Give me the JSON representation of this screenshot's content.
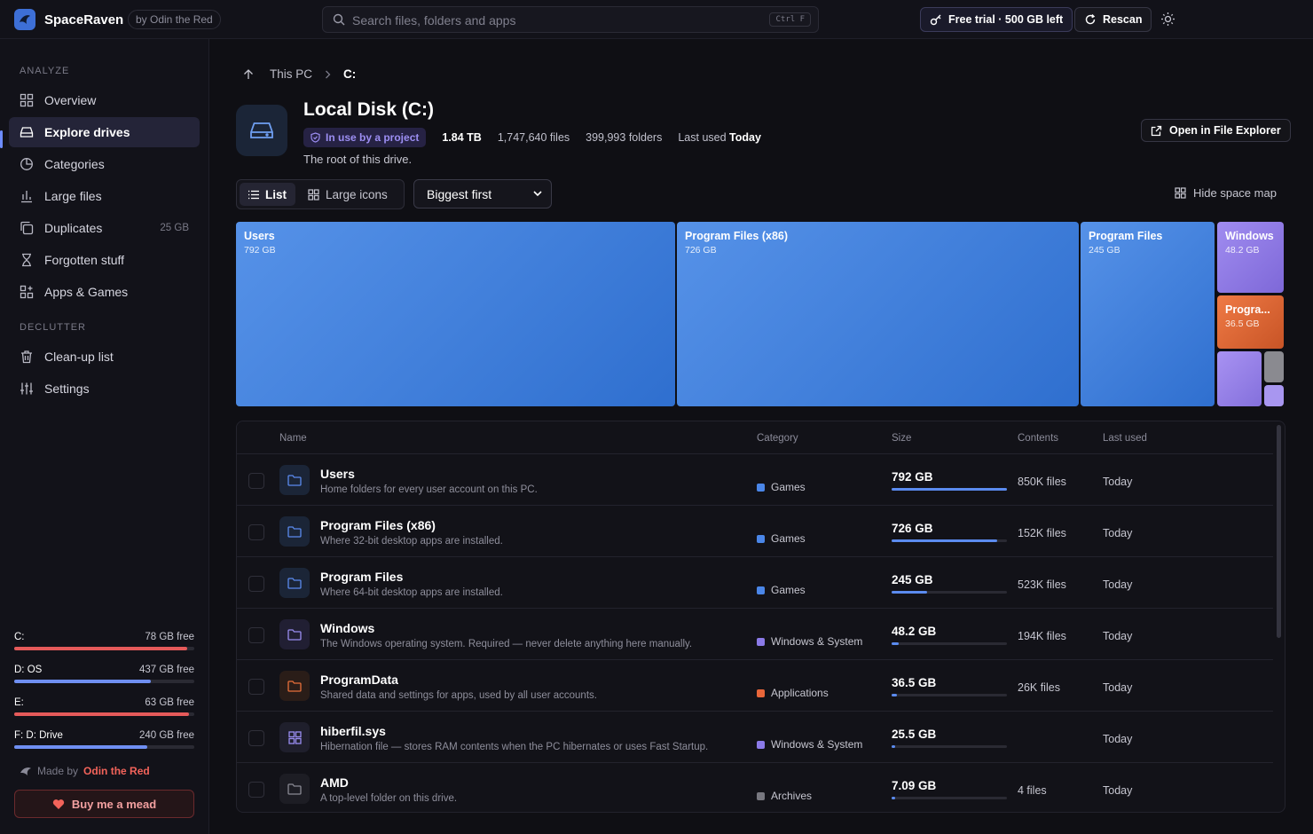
{
  "app": {
    "name": "SpaceRaven",
    "byline": "by Odin the Red"
  },
  "search": {
    "placeholder": "Search files, folders and apps",
    "shortcut": "Ctrl F"
  },
  "topbar": {
    "trial": "Free trial · 500 GB left",
    "rescan": "Rescan"
  },
  "sidebar": {
    "analyze_label": "ANALYZE",
    "declutter_label": "DECLUTTER",
    "items": [
      {
        "label": "Overview",
        "icon": "grid-icon"
      },
      {
        "label": "Explore drives",
        "icon": "drive-icon",
        "active": true
      },
      {
        "label": "Categories",
        "icon": "pie-icon"
      },
      {
        "label": "Large files",
        "icon": "bar-chart-icon"
      },
      {
        "label": "Duplicates",
        "icon": "copy-icon",
        "badge": "25 GB"
      },
      {
        "label": "Forgotten stuff",
        "icon": "hourglass-icon"
      },
      {
        "label": "Apps & Games",
        "icon": "apps-icon"
      }
    ],
    "declutter_items": [
      {
        "label": "Clean-up list",
        "icon": "trash-icon"
      },
      {
        "label": "Settings",
        "icon": "sliders-icon"
      }
    ],
    "drives": [
      {
        "label": "C:",
        "free": "78 GB free",
        "used": 0.96,
        "color": "#e55a5a"
      },
      {
        "label": "D: OS",
        "free": "437 GB free",
        "used": 0.76,
        "color": "#6f8ff2"
      },
      {
        "label": "E:",
        "free": "63 GB free",
        "used": 0.97,
        "color": "#e55a5a"
      },
      {
        "label": "F: D: Drive",
        "free": "240 GB free",
        "used": 0.74,
        "color": "#6f8ff2"
      }
    ],
    "made_by": "Made by",
    "author": "Odin the Red",
    "mead": "Buy me a mead"
  },
  "breadcrumb": {
    "root": "This PC",
    "current": "C:"
  },
  "disk": {
    "title": "Local Disk (C:)",
    "badge": "In use by a project",
    "size": "1.84 TB",
    "files": "1,747,640 files",
    "folders": "399,993 folders",
    "last_used_label": "Last used",
    "last_used": "Today",
    "description": "The root of this drive.",
    "open_explorer": "Open in File Explorer"
  },
  "view": {
    "list": "List",
    "large_icons": "Large icons",
    "sort": "Biggest first",
    "hide_map": "Hide space map"
  },
  "treemap": [
    {
      "name": "Users",
      "size": "792 GB"
    },
    {
      "name": "Program Files (x86)",
      "size": "726 GB"
    },
    {
      "name": "Program Files",
      "size": "245 GB"
    },
    {
      "name": "Windows",
      "size": "48.2 GB"
    },
    {
      "name": "Progra...",
      "size": "36.5 GB"
    }
  ],
  "table": {
    "headers": {
      "name": "Name",
      "category": "Category",
      "size": "Size",
      "contents": "Contents",
      "last_used": "Last used"
    },
    "rows": [
      {
        "name": "Users",
        "desc": "Home folders for every user account on this PC.",
        "category": "Games",
        "cat_color": "#4a86e8",
        "size": "792 GB",
        "fraction": 1.0,
        "contents": "850K files",
        "last": "Today",
        "icon": "folder-icon",
        "icon_color": "#5b8bef"
      },
      {
        "name": "Program Files (x86)",
        "desc": "Where 32-bit desktop apps are installed.",
        "category": "Games",
        "cat_color": "#4a86e8",
        "size": "726 GB",
        "fraction": 0.917,
        "contents": "152K files",
        "last": "Today",
        "icon": "folder-icon",
        "icon_color": "#5b8bef"
      },
      {
        "name": "Program Files",
        "desc": "Where 64-bit desktop apps are installed.",
        "category": "Games",
        "cat_color": "#4a86e8",
        "size": "245 GB",
        "fraction": 0.309,
        "contents": "523K files",
        "last": "Today",
        "icon": "folder-icon",
        "icon_color": "#5b8bef"
      },
      {
        "name": "Windows",
        "desc": "The Windows operating system. Required — never delete anything here manually.",
        "category": "Windows & System",
        "cat_color": "#8b7ae8",
        "size": "48.2 GB",
        "fraction": 0.061,
        "contents": "194K files",
        "last": "Today",
        "icon": "folder-icon",
        "icon_color": "#9a8ef2"
      },
      {
        "name": "ProgramData",
        "desc": "Shared data and settings for apps, used by all user accounts.",
        "category": "Applications",
        "cat_color": "#e8663a",
        "size": "36.5 GB",
        "fraction": 0.046,
        "contents": "26K files",
        "last": "Today",
        "icon": "folder-icon",
        "icon_color": "#e8703a"
      },
      {
        "name": "hiberfil.sys",
        "desc": "Hibernation file — stores RAM contents when the PC hibernates or uses Fast Startup.",
        "category": "Windows & System",
        "cat_color": "#8b7ae8",
        "size": "25.5 GB",
        "fraction": 0.032,
        "contents": "",
        "last": "Today",
        "icon": "windows-icon",
        "icon_color": "#9a8ef2"
      },
      {
        "name": "AMD",
        "desc": "A top-level folder on this drive.",
        "category": "Archives",
        "cat_color": "#77777f",
        "size": "7.09 GB",
        "fraction": 0.009,
        "contents": "4 files",
        "last": "Today",
        "icon": "folder-icon",
        "icon_color": "#8a8a94"
      }
    ]
  }
}
